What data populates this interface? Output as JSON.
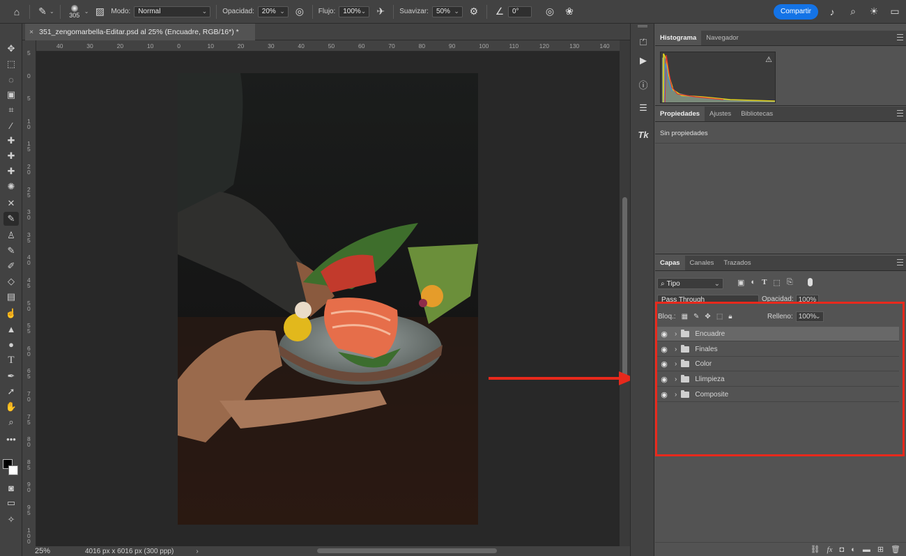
{
  "options_bar": {
    "brush_size": "305",
    "mode_label": "Modo:",
    "mode_value": "Normal",
    "opacity_label": "Opacidad:",
    "opacity_value": "20%",
    "flow_label": "Flujo:",
    "flow_value": "100%",
    "smoothing_label": "Suavizar:",
    "smoothing_value": "50%",
    "angle_value": "0°",
    "share_label": "Compartir"
  },
  "document": {
    "tab_title": "351_zengomarbella-Editar.psd al 25% (Encuadre, RGB/16*) *",
    "zoom": "25%",
    "dimensions": "4016 px x 6016 px (300 ppp)"
  },
  "ruler": {
    "h_ticks": [
      "40",
      "30",
      "20",
      "10",
      "0",
      "10",
      "20",
      "30",
      "40",
      "50",
      "60",
      "70",
      "80",
      "90",
      "100",
      "110",
      "120",
      "130",
      "140"
    ],
    "v_ticks": [
      "5",
      "0",
      "5",
      "1 0",
      "1 5",
      "2 0",
      "2 5",
      "3 0",
      "3 5",
      "4 0",
      "4 5",
      "5 0",
      "5 5",
      "6 0",
      "6 5",
      "7 0",
      "7 5",
      "8 0",
      "8 5",
      "9 0",
      "9 5",
      "1 0 0"
    ]
  },
  "histogram_panel": {
    "tabs": [
      "Histograma",
      "Navegador"
    ],
    "warning": "⚠"
  },
  "properties_panel": {
    "tabs": [
      "Propiedades",
      "Ajustes",
      "Bibliotecas"
    ],
    "empty_text": "Sin propiedades"
  },
  "layers_panel": {
    "tabs": [
      "Capas",
      "Canales",
      "Trazados"
    ],
    "filter_value": "Tipo",
    "blend_mode": "Pass Through",
    "opacity_label": "Opacidad:",
    "opacity_value": "100%",
    "lock_label": "Bloq.:",
    "fill_label": "Relleno:",
    "fill_value": "100%",
    "layers": [
      {
        "name": "Encuadre",
        "selected": true
      },
      {
        "name": "Finales",
        "selected": false
      },
      {
        "name": "Color",
        "selected": false
      },
      {
        "name": "Llimpieza",
        "selected": false
      },
      {
        "name": "Composite",
        "selected": false
      }
    ]
  },
  "colors": {
    "accent": "#1473e6",
    "annotation": "#e8291c",
    "panel_bg": "#535353",
    "chrome_bg": "#424242"
  }
}
